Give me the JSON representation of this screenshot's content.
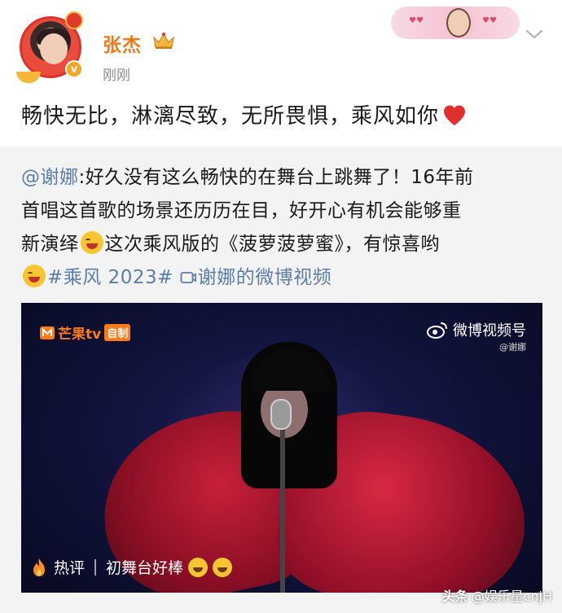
{
  "post": {
    "username": "张杰",
    "timestamp": "刚刚",
    "text": "畅快无比，淋漓尽致，无所畏惧，乘风如你"
  },
  "quoted": {
    "mention": "@谢娜",
    "line1_rest": ":好久没有这么畅快的在舞台上跳舞了！16年前",
    "line2": "首唱这首歌的场景还历历在目，好开心有机会能够重",
    "line3_a": "新演绎",
    "line3_b": "这次乘风版的《菠萝菠萝蜜》，有惊喜哟",
    "hashtag": "#乘风 2023#",
    "video_link": "谢娜的微博视频"
  },
  "video": {
    "mango_label": "芒果tv",
    "mango_tag": "自制",
    "weibo_label": "微博视频号",
    "weibo_sub": "@谢娜",
    "hot_label": "热评",
    "hot_comment": "初舞台好棒"
  },
  "watermark": {
    "source": "头条",
    "account": "@娱乐星cnjH"
  },
  "colors": {
    "username": "#ee7a20",
    "link": "#5b7ea8",
    "quote_bg": "#f3f3f3",
    "heart": "#e0302e"
  }
}
